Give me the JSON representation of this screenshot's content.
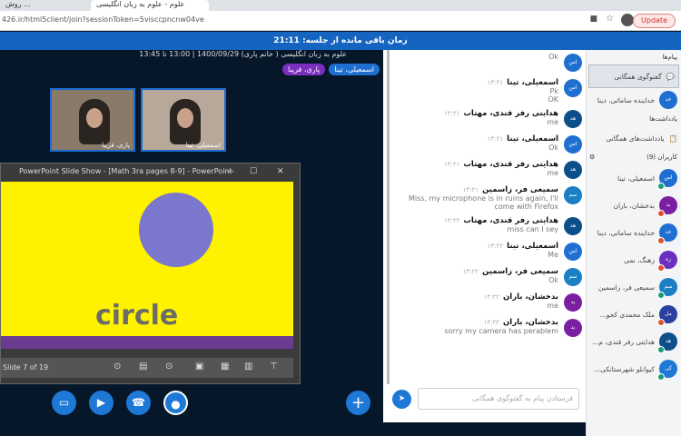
{
  "browser": {
    "tabs": [
      "روش ...",
      "علوم - علوم به زبان انگلیسی"
    ],
    "url": "426.ir/html5client/join?sessionToken=5visccpncnw04ve",
    "update_label": "Update"
  },
  "banner": "زمان باقی مانده از جلسه: 21:11",
  "meeting": {
    "title": "علوم به زبان انگلیسی ( خانم پاری) 1400/09/29 | 13:00 تا 13:45",
    "talkers": [
      {
        "name": "اسمعیلی، تینا",
        "color": "#1e6fd0"
      },
      {
        "name": "پاری، فریبا",
        "color": "#7b2fbf"
      }
    ],
    "videos": [
      "پاری، فریبا",
      "اسمعیلی، تینا"
    ]
  },
  "ppt": {
    "window_title": "PowerPoint Slide Show - [Math 3ra pages 8-9] - PowerPoint",
    "slide_word": "circle",
    "slide_counter": "Slide 7 of 19"
  },
  "chat": {
    "messages": [
      {
        "sender": "",
        "time": "",
        "lines": [
          "Ok"
        ],
        "initials": "اس",
        "color": "#1e6fd0"
      },
      {
        "sender": "اسمعیلی، تینا",
        "time": "۱۳:۲۱",
        "lines": [
          "Pk",
          "OK"
        ],
        "initials": "اس",
        "color": "#1e6fd0"
      },
      {
        "sender": "هدایتی رفر قندی، مهتاب",
        "time": "۱۳:۲۱",
        "lines": [
          "me"
        ],
        "initials": "هد",
        "color": "#0d4f8b"
      },
      {
        "sender": "اسمعیلی، تینا",
        "time": "۱۳:۲۱",
        "lines": [
          "Ok"
        ],
        "initials": "اس",
        "color": "#1e6fd0"
      },
      {
        "sender": "هدایتی رفر قندی، مهتاب",
        "time": "۱۳:۲۱",
        "lines": [
          "me"
        ],
        "initials": "هد",
        "color": "#0d4f8b"
      },
      {
        "sender": "سمیعی فر، زاسمین",
        "time": "۱۳:۲۱",
        "lines": [
          "Miss, my microphone is in ruins again, I'll come with Firefox"
        ],
        "initials": "سم",
        "color": "#1a7fc4"
      },
      {
        "sender": "هدایتی رفر قندی، مهتاب",
        "time": "۱۳:۲۲",
        "lines": [
          "miss can I sey"
        ],
        "initials": "هد",
        "color": "#0d4f8b"
      },
      {
        "sender": "اسمعیلی، تینا",
        "time": "۱۳:۲۲",
        "lines": [
          "Me"
        ],
        "initials": "اس",
        "color": "#1e6fd0"
      },
      {
        "sender": "سمیعی فر، زاسمین",
        "time": "۱۳:۲۲",
        "lines": [
          "Ok"
        ],
        "initials": "سم",
        "color": "#1a7fc4"
      },
      {
        "sender": "بدخشان، باران",
        "time": "۱۳:۲۲",
        "lines": [
          "me"
        ],
        "initials": "بد",
        "color": "#7b1fa2"
      },
      {
        "sender": "بدخشان، باران",
        "time": "۱۳:۲۲",
        "lines": [
          "sorry my camera has perablem"
        ],
        "initials": "بد",
        "color": "#7b1fa2"
      }
    ],
    "input_placeholder": "فرستادن پیام به گفتوگوی همگانی"
  },
  "sidebar": {
    "messages_heading": "پیام‌ها",
    "public_chat": "گفتوگوی همگانی",
    "private_chat": "خداینده ساماتی، دینا",
    "notes_heading": "یادداشت‌ها",
    "shared_notes": "یادداشت‌های همگانی",
    "users_heading": "کاربران (9)",
    "users": [
      {
        "name": "اسمعیلی، تینا",
        "initials": "اس",
        "color": "#1e6fd0",
        "status": "#1a9a7a"
      },
      {
        "name": "بدخشان، باران",
        "initials": "بد",
        "color": "#7b1fa2",
        "status": "#e05030"
      },
      {
        "name": "خداینده ساماتی، دینا",
        "initials": "خد",
        "color": "#1e6fd0",
        "status": "#e05030"
      },
      {
        "name": "زهنگ، نمی",
        "initials": "زه",
        "color": "#6a2fbf",
        "status": "#e05030"
      },
      {
        "name": "سمیعی فر، زاسمین",
        "initials": "سم",
        "color": "#1a7fc4",
        "status": "#1a9a7a"
      },
      {
        "name": "ملک محمدی کجو...",
        "initials": "مل",
        "color": "#2a3f9f",
        "status": "#e05030"
      },
      {
        "name": "هدایتی رفر قندی، م...",
        "initials": "هد",
        "color": "#0d4f8b",
        "status": "#1a9a7a"
      },
      {
        "name": "کیوانلو شهرستانکی...",
        "initials": "کی",
        "color": "#1e78d6",
        "status": "#1a9a7a"
      }
    ]
  }
}
